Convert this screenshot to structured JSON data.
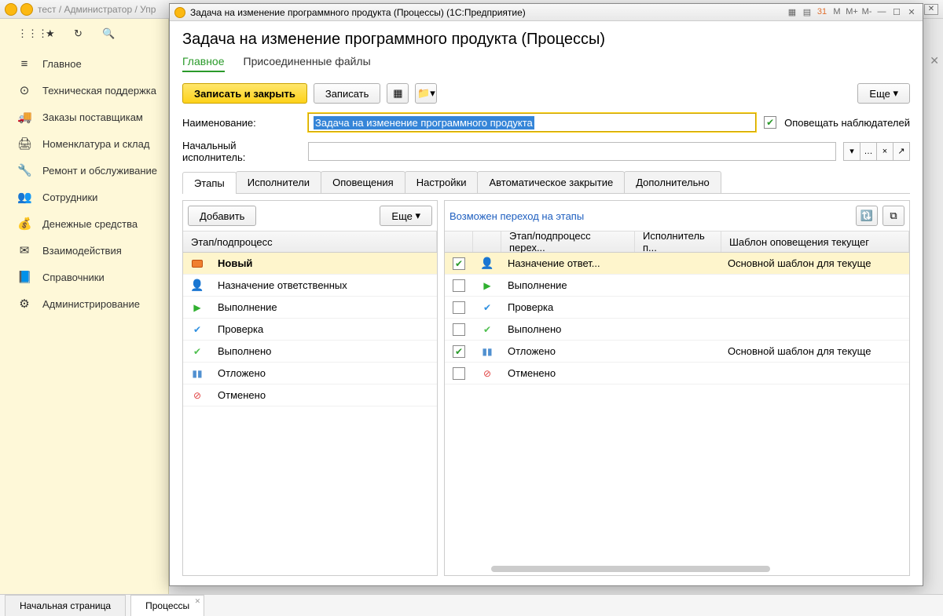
{
  "outerTitle": "тест / Администратор / Упр",
  "outerButtons": {
    "m": "M",
    "mp": "M+",
    "mm": "M-"
  },
  "sidebar": {
    "items": [
      {
        "icon": "≡",
        "label": "Главное"
      },
      {
        "icon": "⊙",
        "label": "Техническая поддержка"
      },
      {
        "icon": "🚚",
        "label": "Заказы поставщикам"
      },
      {
        "icon": "🖨",
        "label": "Номенклатура и склад"
      },
      {
        "icon": "🔧",
        "label": "Ремонт и обслуживание"
      },
      {
        "icon": "👥",
        "label": "Сотрудники"
      },
      {
        "icon": "💰",
        "label": "Денежные средства"
      },
      {
        "icon": "✉",
        "label": "Взаимодействия"
      },
      {
        "icon": "📘",
        "label": "Справочники"
      },
      {
        "icon": "⚙",
        "label": "Администрирование"
      }
    ]
  },
  "modal": {
    "windowTitle": "Задача на изменение программного продукта (Процессы)  (1С:Предприятие)",
    "title": "Задача на изменение программного продукта (Процессы)",
    "subtabs": {
      "main": "Главное",
      "files": "Присоединенные файлы"
    },
    "buttons": {
      "saveClose": "Записать и закрыть",
      "save": "Записать",
      "more": "Еще"
    },
    "fields": {
      "nameLabel": "Наименование:",
      "nameValue": "Задача на изменение программного продукта",
      "notifyLabel": "Оповещать наблюдателей",
      "executorLabel": "Начальный исполнитель:",
      "executorValue": ""
    },
    "tabs": [
      "Этапы",
      "Исполнители",
      "Оповещения",
      "Настройки",
      "Автоматическое закрытие",
      "Дополнительно"
    ],
    "leftPane": {
      "addBtn": "Добавить",
      "moreBtn": "Еще",
      "header": "Этап/подпроцесс",
      "rows": [
        {
          "icon": "new",
          "label": "Новый",
          "sel": true
        },
        {
          "icon": "user",
          "label": "Назначение ответственных"
        },
        {
          "icon": "play",
          "label": "Выполнение"
        },
        {
          "icon": "check",
          "label": "Проверка"
        },
        {
          "icon": "done",
          "label": "Выполнено"
        },
        {
          "icon": "pause",
          "label": "Отложено"
        },
        {
          "icon": "cancel",
          "label": "Отменено"
        }
      ]
    },
    "rightPane": {
      "link": "Возможен переход на этапы",
      "headers": {
        "chk": "",
        "stage": "Этап/подпроцесс перех...",
        "exec": "Исполнитель п...",
        "tpl": "Шаблон оповещения текущег"
      },
      "rows": [
        {
          "checked": true,
          "icon": "user",
          "label": "Назначение ответ...",
          "exec": "",
          "tpl": "Основной шаблон для текуще"
        },
        {
          "checked": false,
          "icon": "play",
          "label": "Выполнение",
          "exec": "",
          "tpl": ""
        },
        {
          "checked": false,
          "icon": "check",
          "label": "Проверка",
          "exec": "",
          "tpl": ""
        },
        {
          "checked": false,
          "icon": "done",
          "label": "Выполнено",
          "exec": "",
          "tpl": ""
        },
        {
          "checked": true,
          "icon": "pause",
          "label": "Отложено",
          "exec": "",
          "tpl": "Основной шаблон для текуще"
        },
        {
          "checked": false,
          "icon": "cancel",
          "label": "Отменено",
          "exec": "",
          "tpl": ""
        }
      ]
    }
  },
  "bottomTabs": {
    "start": "Начальная страница",
    "proc": "Процессы"
  }
}
